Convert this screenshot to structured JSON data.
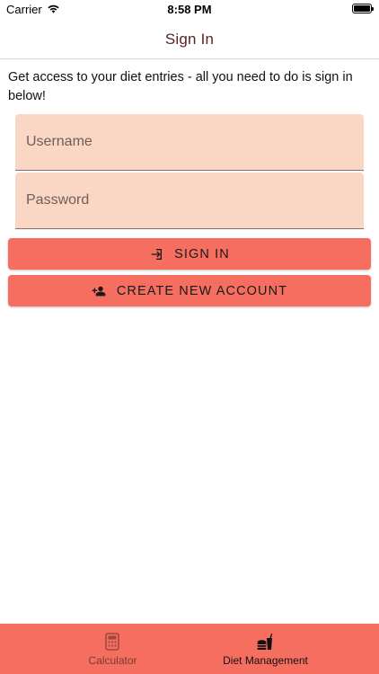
{
  "status_bar": {
    "carrier": "Carrier",
    "time": "8:58 PM"
  },
  "header": {
    "title": "Sign In"
  },
  "intro_text": "Get access to your diet entries - all you need to do is sign in below!",
  "form": {
    "username_placeholder": "Username",
    "username_value": "",
    "password_placeholder": "Password",
    "password_value": ""
  },
  "buttons": {
    "sign_in": {
      "label": "SIGN IN",
      "icon": "login-icon"
    },
    "create_account": {
      "label": "CREATE NEW ACCOUNT",
      "icon": "person-add-icon"
    }
  },
  "tab_bar": {
    "tabs": [
      {
        "label": "Calculator",
        "icon": "calculator-icon",
        "active": false
      },
      {
        "label": "Diet Management",
        "icon": "food-icon",
        "active": true
      }
    ]
  },
  "colors": {
    "accent": "#f56e60",
    "field_bg": "#fad7c5",
    "title": "#5b2424"
  }
}
